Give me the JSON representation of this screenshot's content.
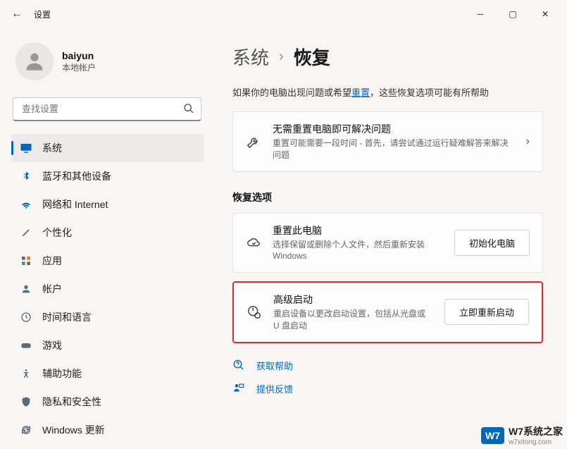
{
  "window": {
    "title": "设置"
  },
  "profile": {
    "name": "baiyun",
    "subtitle": "本地帐户"
  },
  "search": {
    "placeholder": "查找设置"
  },
  "nav": {
    "items": [
      {
        "label": "系统"
      },
      {
        "label": "蓝牙和其他设备"
      },
      {
        "label": "网络和 Internet"
      },
      {
        "label": "个性化"
      },
      {
        "label": "应用"
      },
      {
        "label": "帐户"
      },
      {
        "label": "时间和语言"
      },
      {
        "label": "游戏"
      },
      {
        "label": "辅助功能"
      },
      {
        "label": "隐私和安全性"
      },
      {
        "label": "Windows 更新"
      }
    ]
  },
  "breadcrumb": {
    "root": "系统",
    "sep": "›",
    "current": "恢复"
  },
  "intro": {
    "prefix": "如果你的电脑出现问题或希望",
    "link": "重置",
    "suffix": "，这些恢复选项可能有所帮助"
  },
  "trouble": {
    "title": "无需重置电脑即可解决问题",
    "desc": "重置可能需要一段时间 - 首先，请尝试通过运行疑难解答来解决问题"
  },
  "section": {
    "title": "恢复选项"
  },
  "reset": {
    "title": "重置此电脑",
    "desc": "选择保留或删除个人文件，然后重新安装 Windows",
    "button": "初始化电脑"
  },
  "advanced": {
    "title": "高级启动",
    "desc": "重启设备以更改启动设置，包括从光盘或 U 盘启动",
    "button": "立即重新启动"
  },
  "links": {
    "help": "获取帮助",
    "feedback": "提供反馈"
  },
  "watermark": {
    "badge": "W7",
    "text": "W7系统之家",
    "url": "w7xitong.com"
  }
}
